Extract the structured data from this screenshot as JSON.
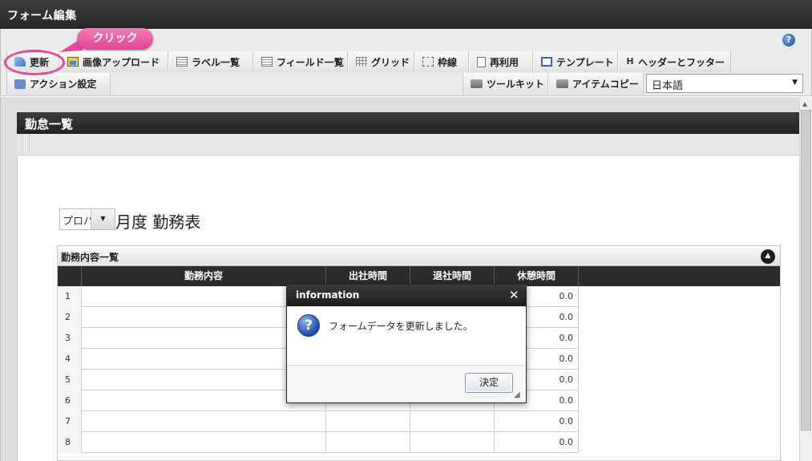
{
  "window": {
    "title": "フォーム編集"
  },
  "callout": {
    "label": "クリック"
  },
  "toolbar": {
    "row1": [
      {
        "label": "更新",
        "icon": "update-icon"
      },
      {
        "label": "画像アップロード",
        "icon": "image-upload-icon"
      },
      {
        "label": "ラベル一覧",
        "icon": "label-list-icon"
      },
      {
        "label": "フィールド一覧",
        "icon": "field-list-icon"
      },
      {
        "label": "グリッド",
        "icon": "grid-icon"
      },
      {
        "label": "枠線",
        "icon": "border-icon"
      },
      {
        "label": "再利用",
        "icon": "reuse-icon"
      },
      {
        "label": "テンプレート",
        "icon": "template-icon"
      },
      {
        "label": "ヘッダーとフッター",
        "icon": "header-footer-icon"
      }
    ],
    "row2_left": [
      {
        "label": "アクション設定",
        "icon": "action-icon"
      }
    ],
    "row2_right": [
      {
        "label": "ツールキット",
        "icon": "toolkit-icon"
      },
      {
        "label": "アイテムコピー",
        "icon": "item-copy-icon"
      }
    ],
    "language": "日本語"
  },
  "form": {
    "title": "勤怠一覧",
    "year_value": "プロパ",
    "sheet_title": "月度 勤務表",
    "panel_title": "勤務内容一覧",
    "columns": [
      "勤務内容",
      "出社時間",
      "退社時間",
      "休憩時間"
    ],
    "rows": [
      {
        "no": "1",
        "break": "0.0"
      },
      {
        "no": "2",
        "break": "0.0"
      },
      {
        "no": "3",
        "break": "0.0"
      },
      {
        "no": "4",
        "break": "0.0"
      },
      {
        "no": "5",
        "break": "0.0"
      },
      {
        "no": "6",
        "break": "0.0"
      },
      {
        "no": "7",
        "break": "0.0"
      },
      {
        "no": "8",
        "break": "0.0"
      }
    ]
  },
  "dialog": {
    "title": "information",
    "message": "フォームデータを更新しました。",
    "ok_label": "決定"
  }
}
